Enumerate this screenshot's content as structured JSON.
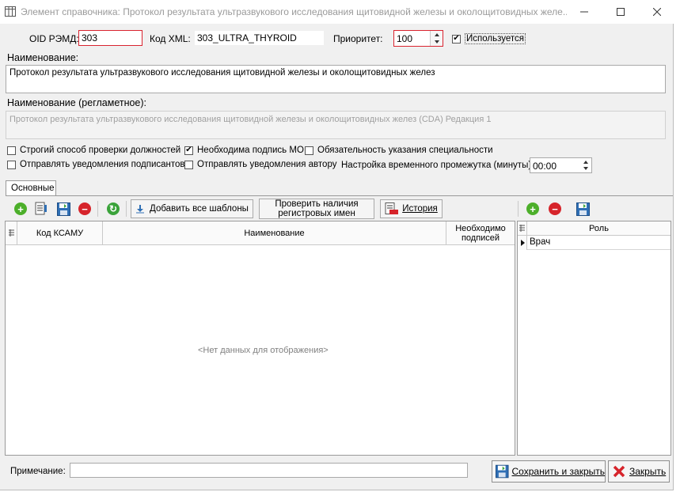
{
  "window": {
    "title": "Элемент справочника: Протокол результата ультразвукового исследования щитовидной железы и околощитовидных желе...",
    "minimize": "—",
    "maximize": "☐",
    "close": "✕"
  },
  "form": {
    "oid_label": "OID РЭМД:",
    "oid_value": "303",
    "xml_label": "Код XML:",
    "xml_value": "303_ULTRA_THYROID",
    "priority_label": "Приоритет:",
    "priority_value": "100",
    "used_label": "Используется",
    "used_checked": "✔",
    "name_label": "Наименование:",
    "name_value": "Протокол результата ультразвукового исследования щитовидной железы и околощитовидных желез",
    "reg_name_label": "Наименование (регламетное):",
    "reg_name_value": "Протокол результата ультразвукового исследования щитовидной железы и околощитовидных желез (CDA) Редакция 1",
    "options": {
      "strict_check": "Строгий способ проверки должностей",
      "mo_signature": "Необходима подпись МО",
      "mo_signature_checked": "✔",
      "specialty_required": "Обязательность указания специальности",
      "notify_signers": "Отправлять уведомления подписантов",
      "notify_author": "Отправлять уведомления автору",
      "time_range_label": "Настройка временного промежутка (минуты):",
      "time_range_value": "00:00"
    }
  },
  "tabs": {
    "main": "Основные"
  },
  "left_panel": {
    "toolbar": {
      "add_all_templates": "Добавить все шаблоны",
      "check_registry": "Проверить наличия регистровых имен",
      "history": "История"
    },
    "grid": {
      "col_code": "Код КСАМУ",
      "col_name": "Наименование",
      "col_signatures": "Необходимо подписей",
      "empty": "<Нет данных для отображения>"
    }
  },
  "right_panel": {
    "grid": {
      "col_role": "Роль",
      "rows": [
        {
          "role": "Врач"
        }
      ]
    }
  },
  "footer": {
    "note_label": "Примечание:",
    "note_value": "",
    "save_close": "Сохранить и закрыть",
    "close": "Закрыть"
  },
  "colors": {
    "add": "#4caf2a",
    "remove": "#d6242b",
    "refresh": "#3aa33a",
    "save": "#2f6fb5",
    "required_border": "#d9232f"
  }
}
